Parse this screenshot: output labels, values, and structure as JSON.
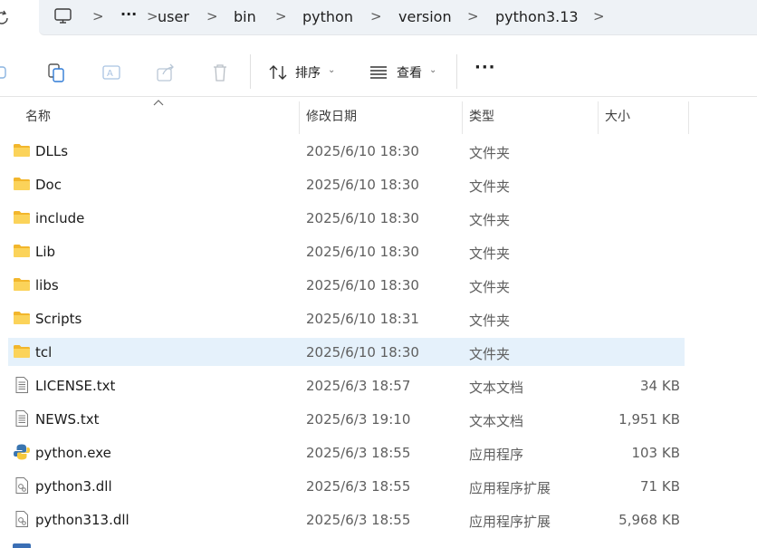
{
  "address": {
    "crumbs": [
      "user",
      "bin",
      "python",
      "version",
      "python3.13"
    ],
    "overflow": "···"
  },
  "toolbar": {
    "sort_label": "排序",
    "view_label": "查看",
    "more_label": "···"
  },
  "columns": {
    "name": "名称",
    "modified": "修改日期",
    "type": "类型",
    "size": "大小"
  },
  "files": [
    {
      "name": "DLLs",
      "modified": "2025/6/10 18:30",
      "type": "文件夹",
      "size": "",
      "icon": "folder-icon"
    },
    {
      "name": "Doc",
      "modified": "2025/6/10 18:30",
      "type": "文件夹",
      "size": "",
      "icon": "folder-icon"
    },
    {
      "name": "include",
      "modified": "2025/6/10 18:30",
      "type": "文件夹",
      "size": "",
      "icon": "folder-icon"
    },
    {
      "name": "Lib",
      "modified": "2025/6/10 18:30",
      "type": "文件夹",
      "size": "",
      "icon": "folder-icon"
    },
    {
      "name": "libs",
      "modified": "2025/6/10 18:30",
      "type": "文件夹",
      "size": "",
      "icon": "folder-icon"
    },
    {
      "name": "Scripts",
      "modified": "2025/6/10 18:31",
      "type": "文件夹",
      "size": "",
      "icon": "folder-icon"
    },
    {
      "name": "tcl",
      "modified": "2025/6/10 18:30",
      "type": "文件夹",
      "size": "",
      "icon": "folder-icon",
      "selected": true
    },
    {
      "name": "LICENSE.txt",
      "modified": "2025/6/3 18:57",
      "type": "文本文档",
      "size": "34 KB",
      "icon": "text-file-icon"
    },
    {
      "name": "NEWS.txt",
      "modified": "2025/6/3 19:10",
      "type": "文本文档",
      "size": "1,951 KB",
      "icon": "text-file-icon"
    },
    {
      "name": "python.exe",
      "modified": "2025/6/3 18:55",
      "type": "应用程序",
      "size": "103 KB",
      "icon": "python-exe-icon"
    },
    {
      "name": "python3.dll",
      "modified": "2025/6/3 18:55",
      "type": "应用程序扩展",
      "size": "71 KB",
      "icon": "dll-file-icon"
    },
    {
      "name": "python313.dll",
      "modified": "2025/6/3 18:55",
      "type": "应用程序扩展",
      "size": "5,968 KB",
      "icon": "dll-file-icon"
    }
  ],
  "colors": {
    "selected_row": "#e5f1fb",
    "folder": "#f5c542",
    "address_bg": "#eef2f6"
  }
}
